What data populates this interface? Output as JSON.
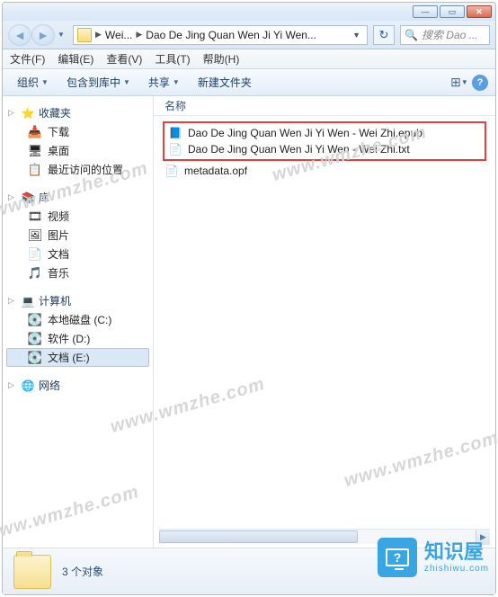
{
  "breadcrumb": {
    "seg1": "Wei...",
    "seg2": "Dao De Jing Quan Wen Ji Yi Wen..."
  },
  "search": {
    "placeholder": "搜索 Dao ..."
  },
  "menu": {
    "file": "文件(F)",
    "edit": "编辑(E)",
    "view": "查看(V)",
    "tools": "工具(T)",
    "help": "帮助(H)"
  },
  "toolbar": {
    "organize": "组织",
    "include": "包含到库中",
    "share": "共享",
    "newfolder": "新建文件夹"
  },
  "column": {
    "name": "名称"
  },
  "sidebar": {
    "favorites": {
      "label": "收藏夹",
      "items": [
        "下载",
        "桌面",
        "最近访问的位置"
      ]
    },
    "libraries": {
      "label": "库",
      "items": [
        "视频",
        "图片",
        "文档",
        "音乐"
      ]
    },
    "computer": {
      "label": "计算机",
      "items": [
        "本地磁盘 (C:)",
        "软件 (D:)",
        "文档 (E:)"
      ],
      "selected": 2
    },
    "network": {
      "label": "网络"
    }
  },
  "files": {
    "highlighted": [
      "Dao De Jing Quan Wen Ji Yi Wen - Wei Zhi.epub",
      "Dao De Jing Quan Wen Ji Yi Wen - Wei Zhi.txt"
    ],
    "other": [
      "metadata.opf"
    ]
  },
  "details": {
    "count": "3 个对象"
  },
  "watermark": "www.wmzhe.com",
  "badge": {
    "cn": "知识屋",
    "en": "zhishiwu.com"
  }
}
